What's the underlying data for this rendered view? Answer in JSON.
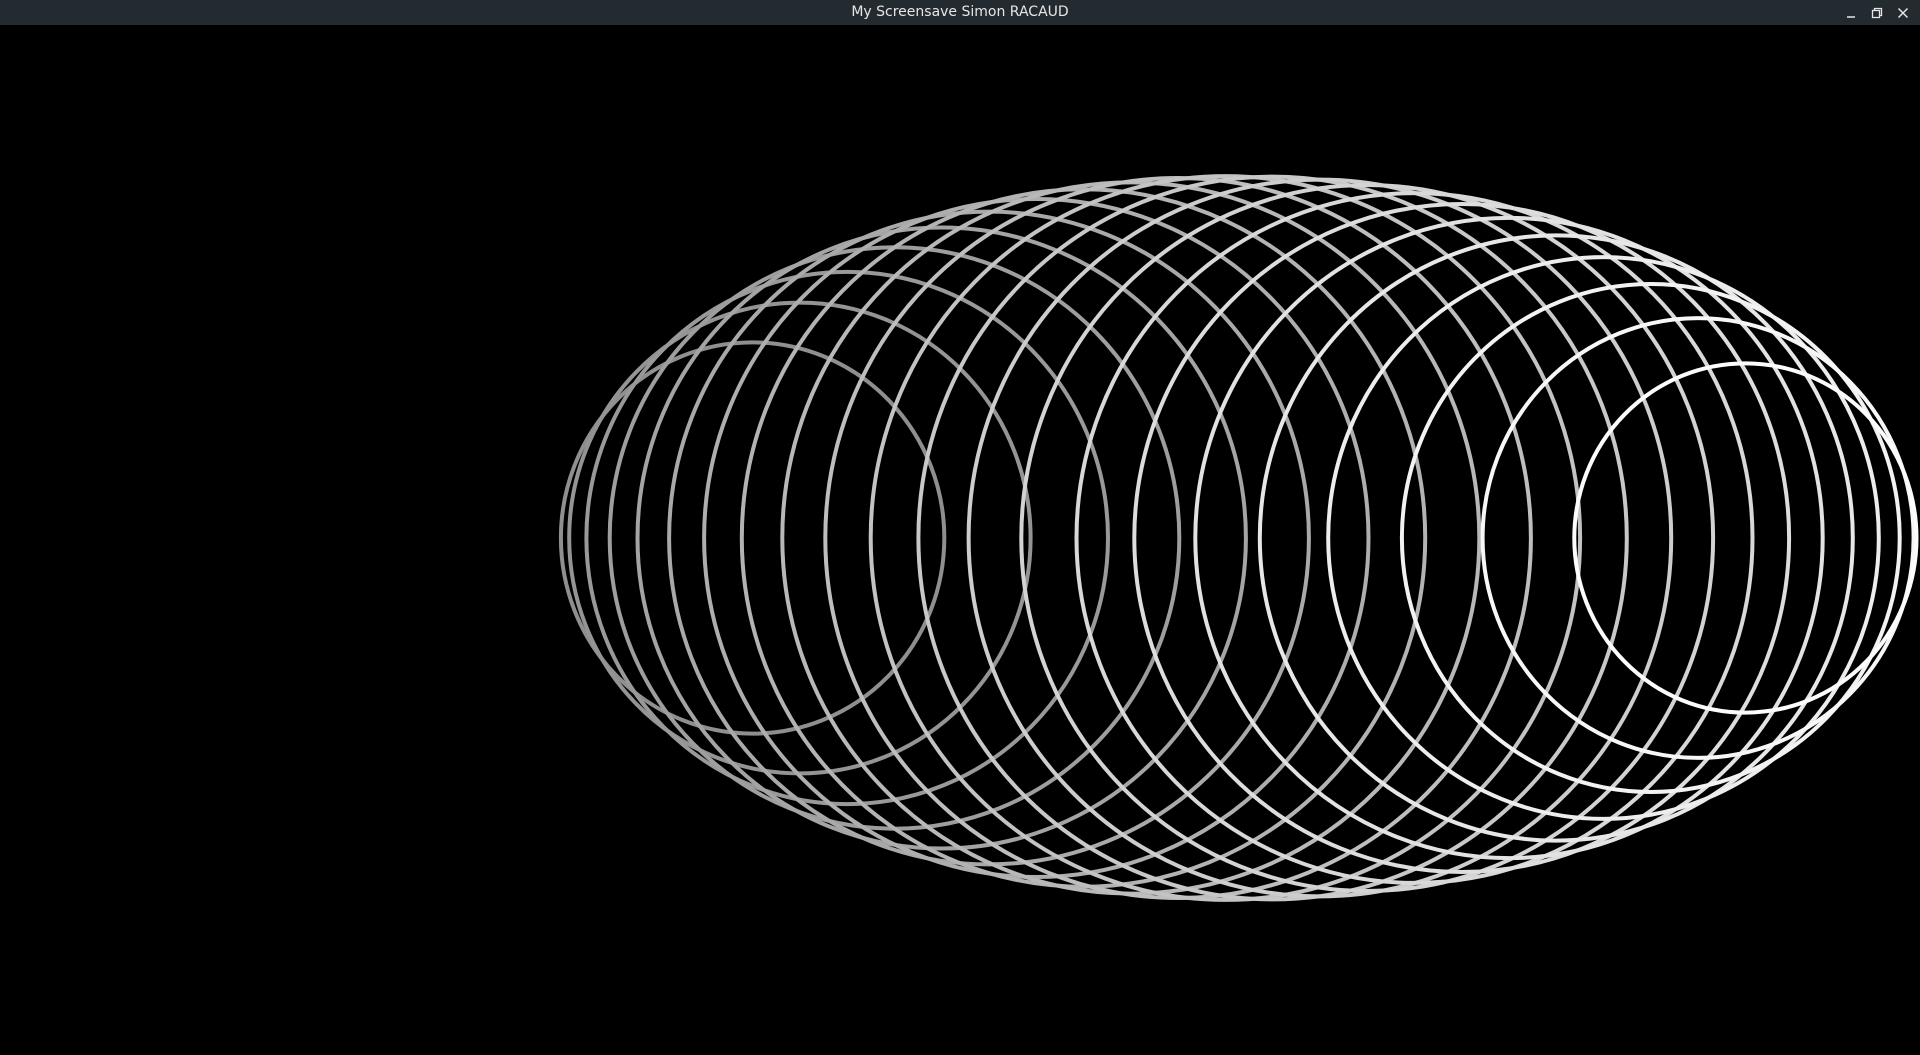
{
  "window": {
    "title": "My Screensave Simon RACAUD",
    "controls": [
      {
        "name": "minimize-button",
        "icon": "minimize-icon"
      },
      {
        "name": "maximize-button",
        "icon": "restore-icon"
      },
      {
        "name": "close-button",
        "icon": "close-icon"
      }
    ]
  },
  "canvas": {
    "background": "#000000",
    "ring_color_dim": "#8c8c8c",
    "ring_color_bright": "#ffffff",
    "ring_count": 22,
    "scene": "wireframe-ellipsoid-of-rings"
  },
  "titlebar": {
    "background": "#232a30",
    "text_color": "#e6e6e6"
  }
}
